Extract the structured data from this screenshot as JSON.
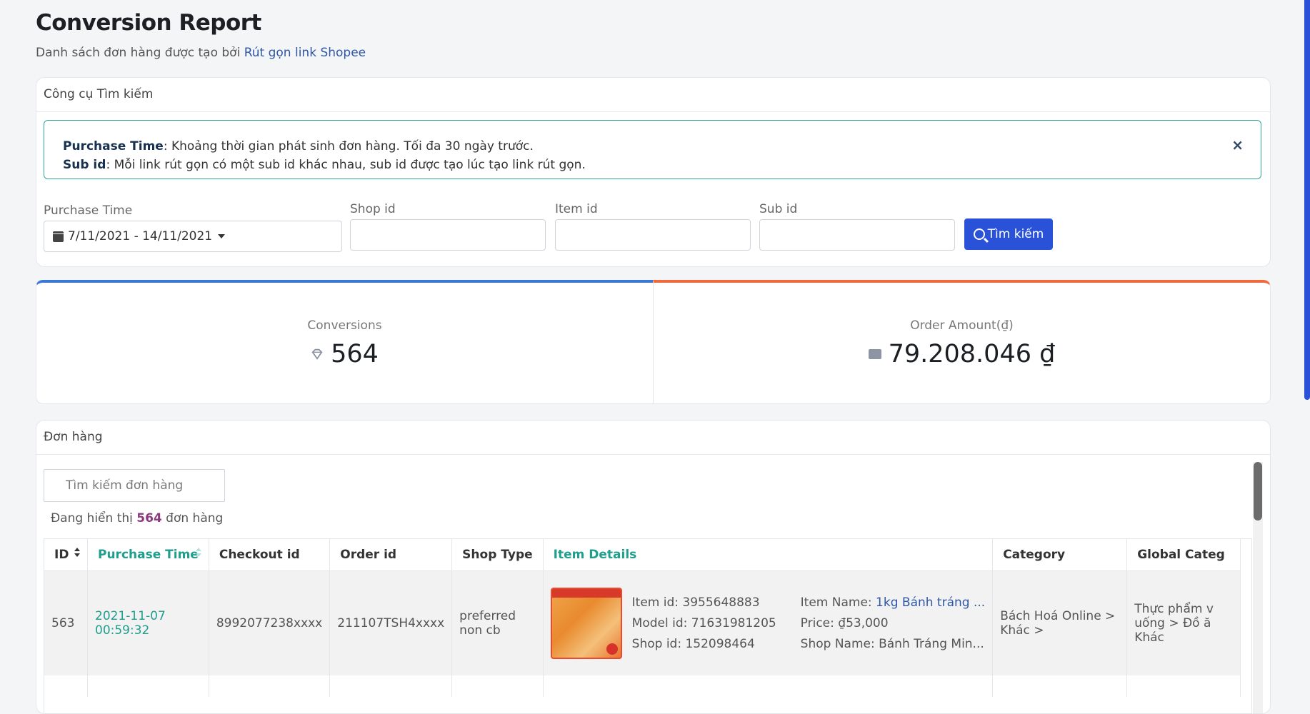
{
  "header": {
    "title": "Conversion Report",
    "subtitle_prefix": "Danh sách đơn hàng được tạo bởi",
    "subtitle_link": "Rút gọn link Shopee"
  },
  "search_card": {
    "title": "Công cụ Tìm kiếm",
    "alert": {
      "line1_label": "Purchase Time",
      "line1_text": ": Khoảng thời gian phát sinh đơn hàng. Tối đa 30 ngày trước.",
      "line2_label": "Sub id",
      "line2_text": ": Mỗi link rút gọn có một sub id khác nhau, sub id được tạo lúc tạo link rút gọn.",
      "close_label": "×"
    },
    "fields": {
      "purchase_time_label": "Purchase Time",
      "purchase_time_value": "7/11/2021 - 14/11/2021",
      "shop_id_label": "Shop id",
      "item_id_label": "Item id",
      "sub_id_label": "Sub id"
    },
    "search_button": "Tìm kiếm"
  },
  "stats": {
    "conversions_label": "Conversions",
    "conversions_value": "564",
    "amount_label": "Order Amount(₫)",
    "amount_value": "79.208.046 ₫",
    "colors": {
      "conversions_accent": "#3a78d4",
      "amount_accent": "#ef6a3d"
    }
  },
  "orders": {
    "title": "Đơn hàng",
    "search_placeholder": "Tìm kiếm đơn hàng",
    "showing_prefix": "Đang hiển thị",
    "showing_count": "564",
    "showing_suffix": "đơn hàng",
    "columns": [
      "ID",
      "Purchase Time",
      "Checkout id",
      "Order id",
      "Shop Type",
      "Item Details",
      "Category",
      "Global Categ"
    ],
    "rows": [
      {
        "id": "563",
        "purchase_time": "2021-11-07 00:59:32",
        "checkout_id": "8992077238xxxx",
        "order_id": "211107TSH4xxxx",
        "shop_type_1": "preferred",
        "shop_type_2": "non cb",
        "item_id": "Item id: 3955648883",
        "model_id": "Model id: 71631981205",
        "shop_id": "Shop id: 152098464",
        "item_name_label": "Item Name: ",
        "item_name": "1kg Bánh tráng ...",
        "price": "Price:   ₫53,000",
        "shop_name": "Shop Name: Bánh Tráng Min...",
        "category_1": "Bách Hoá Online >",
        "category_2": "Khác >",
        "global_category_1": "Thực phẩm v",
        "global_category_2": "uống > Đồ ă",
        "global_category_3": "Khác"
      }
    ]
  },
  "colors": {
    "primary": "#2a52d9",
    "teal": "#1f9e8d",
    "alert_border": "#2fa89a"
  }
}
